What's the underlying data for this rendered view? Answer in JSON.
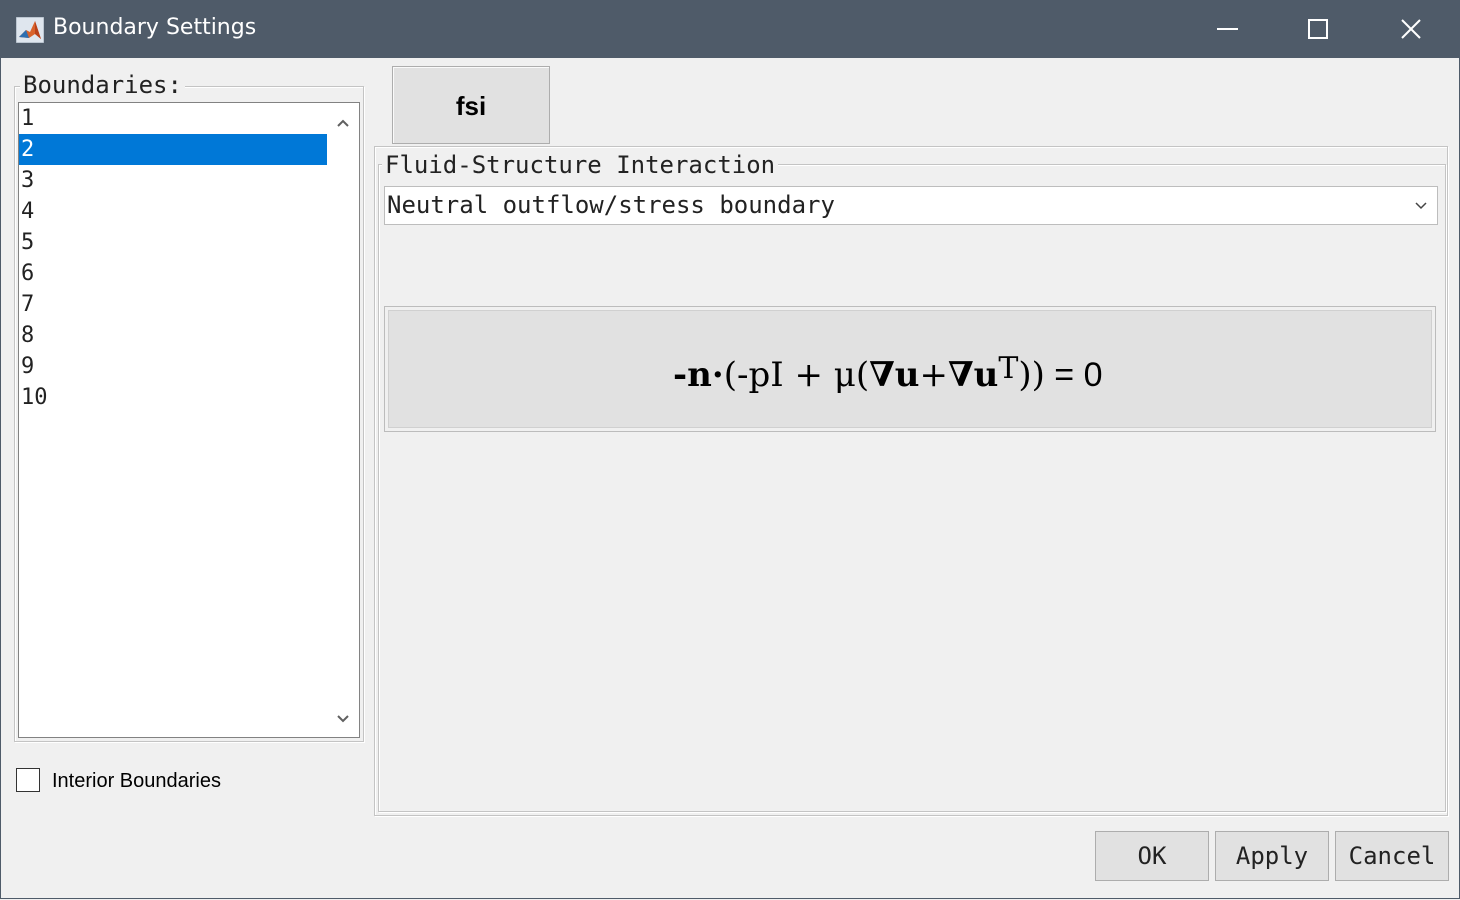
{
  "window": {
    "title": "Boundary Settings",
    "app_icon": "matlab-icon",
    "controls": [
      "minimize-icon",
      "maximize-icon",
      "close-icon"
    ]
  },
  "boundaries": {
    "legend": "Boundaries:",
    "items": [
      "1",
      "2",
      "3",
      "4",
      "5",
      "6",
      "7",
      "8",
      "9",
      "10"
    ],
    "selected": "2"
  },
  "interior": {
    "label": "Interior Boundaries",
    "checked": false
  },
  "tab": {
    "label": "fsi"
  },
  "fsi_group": {
    "legend": "Fluid-Structure Interaction",
    "condition": "Neutral outflow/stress boundary"
  },
  "equation": {
    "neg": "-",
    "n": "n",
    "dot": "·",
    "open": "(-pI + μ(",
    "nabla1": "∇",
    "u1": "u",
    "plus": "+",
    "nabla2": "∇",
    "u2": "u",
    "sup": "T",
    "close": "))",
    "rhs": " = 0"
  },
  "buttons": {
    "ok": "OK",
    "apply": "Apply",
    "cancel": "Cancel"
  },
  "colors": {
    "titlebar": "#4f5b69",
    "selection": "#0078d7",
    "background": "#f0f0f0"
  }
}
